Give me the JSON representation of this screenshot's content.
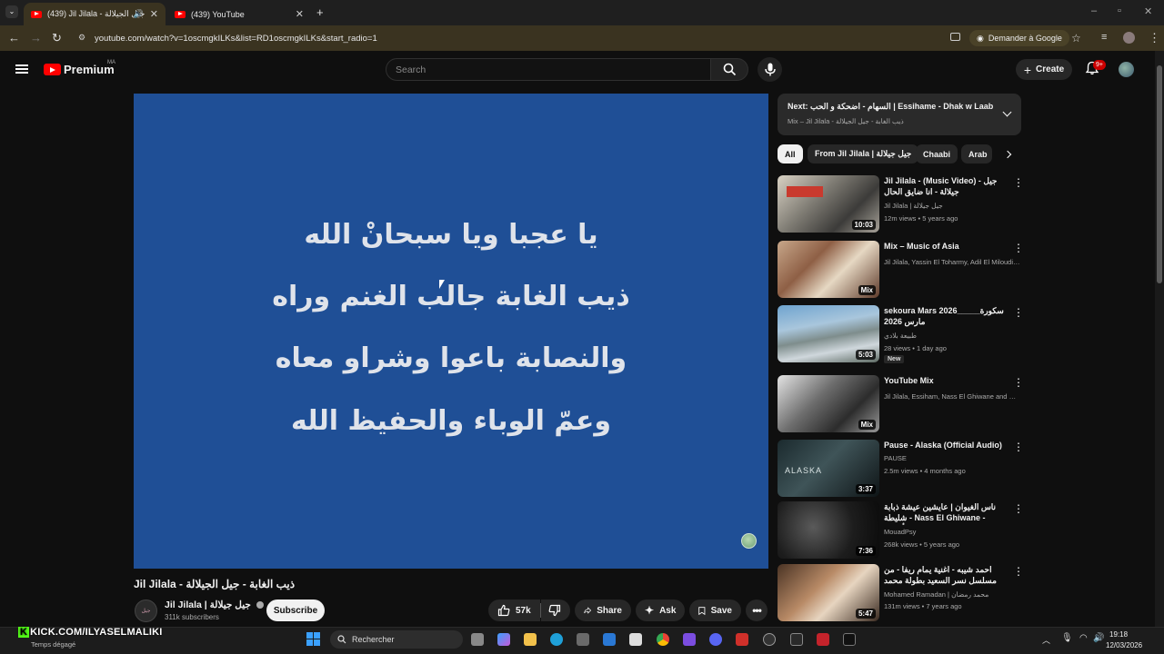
{
  "browser": {
    "tabs": [
      {
        "title": "(439) Jil Jilala - جيل الجيلالة",
        "active": true
      },
      {
        "title": "(439) YouTube",
        "active": false
      }
    ],
    "url": "youtube.com/watch?v=1oscmgkILKs&list=RD1oscmgkILKs&start_radio=1",
    "translate_label": "Demander à Google"
  },
  "header": {
    "logo_text": "Premium",
    "logo_country": "MA",
    "search_placeholder": "Search",
    "create_label": "Create",
    "notif_count": "9+"
  },
  "player": {
    "lyrics": [
      "يا عجبا ويا سبحانْ الله",
      "ذيب الغابة جالب الغنم وراه",
      "والنصابة باعوا وشراو معاه",
      "وعمّ الوباء والحفيظ الله"
    ]
  },
  "video": {
    "title": "Jil Jilala - ذيب الغابة - جيل الجيلالة",
    "channel_name": "Jil Jilala | جيل جيلالة",
    "subscribers": "311k subscribers",
    "subscribe_label": "Subscribe",
    "likes": "57k",
    "share_label": "Share",
    "ask_label": "Ask",
    "save_label": "Save"
  },
  "next": {
    "label": "Next:",
    "title": "السهام - اضحكة و الحب | Essihame - Dhak w Laab",
    "subtitle": "Mix – Jil Jilala - ذيب الغابة - جيل الجيلالة"
  },
  "chips": [
    "All",
    "From Jil Jilala | جيل جيلالة",
    "Chaabi",
    "Arab"
  ],
  "recommendations": [
    {
      "title": "Jil Jilala - (Music Video) - جيل جيلالة - انا ضايق الحال",
      "channel": "Jil Jilala | جيل جيلالة",
      "meta": "12m views • 5 years ago",
      "duration": "10:03",
      "new": ""
    },
    {
      "title": "Mix – Music of Asia",
      "channel": "Jil Jilala, Yassin El Toharmy, Adil El Miloudi and more",
      "meta": "",
      "duration": "Mix",
      "new": ""
    },
    {
      "title": "sekoura Mars 2026_____سكورة مارس 2026",
      "channel": "طبيعة بلادي",
      "meta": "28 views • 1 day ago",
      "duration": "5:03",
      "new": "New"
    },
    {
      "title": "YouTube Mix",
      "channel": "Jil Jilala, Essiham, Nass El Ghiwane and more",
      "meta": "",
      "duration": "Mix",
      "new": ""
    },
    {
      "title": "Pause - Alaska (Official Audio)",
      "channel": "PAUSE",
      "meta": "2.5m views • 4 months ago",
      "duration": "3:37",
      "new": ""
    },
    {
      "title": "ناس الغيوان | عايشين عيشة ذبابة ﺷﻠﻴﻄﺔ - Nass El Ghiwane - ﺃﺑﻄﺎﻟﺔ",
      "channel": "MouadPsy",
      "meta": "268k views • 5 years ago",
      "duration": "7:36",
      "new": ""
    },
    {
      "title": "احمد شيبه - اغنية يمام ريفا - من مسلسل نسر السعيد بطولة محمد رمضان | Nesr El ...",
      "channel": "Mohamed Ramadan | محمد رمضان",
      "meta": "131m views • 7 years ago",
      "duration": "5:47",
      "new": ""
    }
  ],
  "taskbar": {
    "overlay_text": "KICK.COM/ILYASELMALIKI",
    "weather": "Temps dégagé",
    "search_label": "Rechercher",
    "time": "19:18",
    "date": "12/03/2026"
  },
  "colors": {
    "player_bg": "#1f4f96",
    "accent_red": "#ff0000",
    "page_bg": "#0f0f0f"
  }
}
